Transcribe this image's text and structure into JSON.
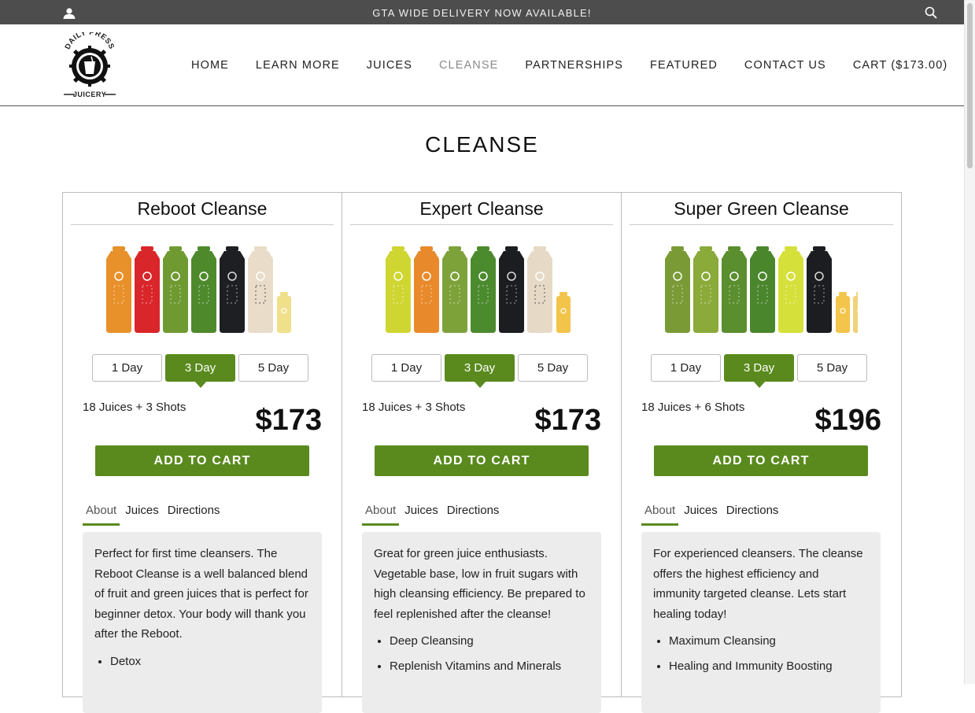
{
  "topbar": {
    "message": "GTA WIDE DELIVERY NOW AVAILABLE!",
    "user_icon": "user-icon",
    "search_icon": "search-icon"
  },
  "logo": {
    "text_top": "DAILY PRESS",
    "text_bottom": "JUICERY"
  },
  "nav": [
    {
      "label": "HOME"
    },
    {
      "label": "LEARN MORE"
    },
    {
      "label": "JUICES"
    },
    {
      "label": "CLEANSE",
      "active": true
    },
    {
      "label": "PARTNERSHIPS"
    },
    {
      "label": "FEATURED"
    },
    {
      "label": "CONTACT US"
    },
    {
      "label": "CART ($173.00)"
    }
  ],
  "page_title": "CLEANSE",
  "accent_color": "#5a8a1e",
  "cleanses": [
    {
      "name": "Reboot Cleanse",
      "days": [
        "1 Day",
        "3 Day",
        "5 Day"
      ],
      "selected_day": "3 Day",
      "contents": "18 Juices + 3 Shots",
      "price": "$173",
      "add_to_cart": "ADD TO CART",
      "tabs": [
        "About",
        "Juices",
        "Directions"
      ],
      "active_tab": "About",
      "about": "Perfect for first time cleansers. The Reboot Cleanse is a well balanced blend of fruit and green juices that is perfect for beginner detox. Your body will thank you after the Reboot.",
      "bullets": [
        "Detox"
      ]
    },
    {
      "name": "Expert Cleanse",
      "days": [
        "1 Day",
        "3 Day",
        "5 Day"
      ],
      "selected_day": "3 Day",
      "contents": "18 Juices + 3 Shots",
      "price": "$173",
      "add_to_cart": "ADD TO CART",
      "tabs": [
        "About",
        "Juices",
        "Directions"
      ],
      "active_tab": "About",
      "about": "Great for green juice enthusiasts. Vegetable base, low in fruit sugars with high cleansing efficiency. Be prepared to feel replenished after the cleanse!",
      "bullets": [
        "Deep Cleansing",
        "Replenish Vitamins and Minerals"
      ]
    },
    {
      "name": "Super Green Cleanse",
      "days": [
        "1 Day",
        "3 Day",
        "5 Day"
      ],
      "selected_day": "3 Day",
      "contents": "18 Juices + 6 Shots",
      "price": "$196",
      "add_to_cart": "ADD TO CART",
      "tabs": [
        "About",
        "Juices",
        "Directions"
      ],
      "active_tab": "About",
      "about": "For experienced cleansers. The cleanse offers the highest efficiency and immunity targeted cleanse. Lets start healing today!",
      "bullets": [
        "Maximum Cleansing",
        "Healing and Immunity Boosting"
      ]
    }
  ],
  "bottle_sets": [
    {
      "bottles": [
        "#e8902a",
        "#d8262a",
        "#6f9a32",
        "#4e8a2c",
        "#1d1f22",
        "#e9dcc8"
      ],
      "shots": [
        "#f0e08a"
      ]
    },
    {
      "bottles": [
        "#cfd631",
        "#e88a2c",
        "#7ea23a",
        "#4c8a2e",
        "#1b1d20",
        "#e6dac6"
      ],
      "shots": [
        "#f2c44a"
      ]
    },
    {
      "bottles": [
        "#7a9a36",
        "#8aaa3a",
        "#5a8e2e",
        "#4a862c",
        "#d6e03a",
        "#1b1d20"
      ],
      "shots": [
        "#f3c54a",
        "#f0d27a"
      ]
    }
  ]
}
